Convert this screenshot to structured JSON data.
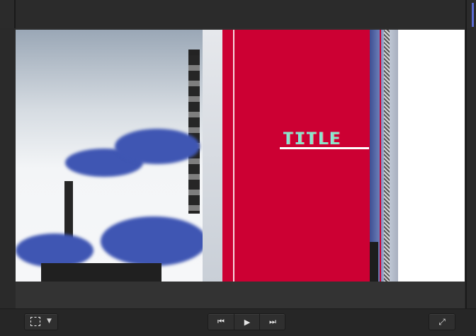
{
  "viewer": {
    "title_overlay": "TITLE"
  },
  "colors": {
    "red_block": "#cc0033",
    "title_text": "#8de6c8",
    "smoke_blue": "#3f56b3"
  },
  "toolbar": {
    "crop_icon": "crop-icon",
    "crop_menu_icon": "chevron-down-icon",
    "transport": {
      "previous_icon": "skip-back-icon",
      "play_icon": "play-icon",
      "next_icon": "skip-forward-icon"
    },
    "fullscreen_icon": "fullscreen-icon"
  }
}
